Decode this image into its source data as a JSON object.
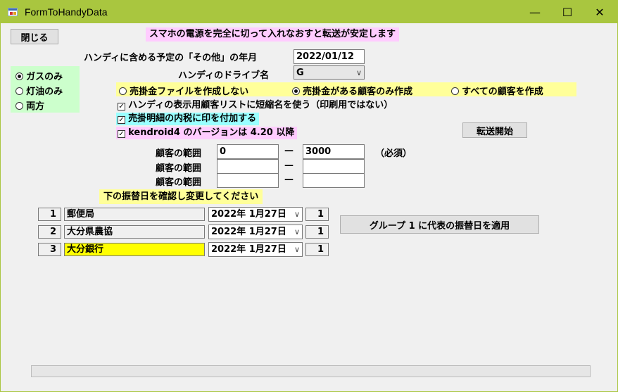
{
  "window": {
    "title": "FormToHandyData",
    "minimize_glyph": "—",
    "maximize_glyph": "☐",
    "close_glyph": "✕"
  },
  "colors": {
    "titlebar": "#a9c63f",
    "pink": "#ffccff",
    "yellow": "#ffff99",
    "cyan": "#99ffff",
    "green": "#ccffcc",
    "field_yellow": "#ffff00"
  },
  "close_button": "閉じる",
  "notice": "スマホの電源を完全に切って入れなおすと転送が安定します",
  "other_year_month": {
    "label": "ハンディに含める予定の「その他」の年月",
    "value": "2022/01/12"
  },
  "drive": {
    "label": "ハンディのドライブ名",
    "value": "G"
  },
  "fuel_options": [
    {
      "label": "ガスのみ",
      "selected": true
    },
    {
      "label": "灯油のみ",
      "selected": false
    },
    {
      "label": "両方",
      "selected": false
    }
  ],
  "ar_options": [
    {
      "label": "売掛金ファイルを作成しない",
      "selected": false
    },
    {
      "label": "売掛金がある顧客のみ作成",
      "selected": true
    },
    {
      "label": "すべての顧客を作成",
      "selected": false
    }
  ],
  "checkboxes": [
    {
      "label": "ハンディの表示用顧客リストに短縮名を使う（印刷用ではない）",
      "checked": true
    },
    {
      "label": "売掛明細の内税に印を付加する",
      "checked": true
    },
    {
      "label": "kendroid4 のバージョンは 4.20 以降",
      "checked": true
    }
  ],
  "transfer_button": "転送開始",
  "ranges": [
    {
      "label": "顧客の範囲",
      "from": "0",
      "to": "3000",
      "note": "（必須）"
    },
    {
      "label": "顧客の範囲",
      "from": "",
      "to": "",
      "note": ""
    },
    {
      "label": "顧客の範囲",
      "from": "",
      "to": "",
      "note": ""
    }
  ],
  "range_dash": "—",
  "confirm_notice": "下の振替日を確認し変更してください",
  "banks": [
    {
      "no": "1",
      "name": "郵便局",
      "date": "2022年  1月27日",
      "group": "1"
    },
    {
      "no": "2",
      "name": "大分県農協",
      "date": "2022年  1月27日",
      "group": "1"
    },
    {
      "no": "3",
      "name": "大分銀行",
      "date": "2022年  1月27日",
      "group": "1"
    }
  ],
  "apply_group_button": "グループ 1 に代表の振替日を適用"
}
